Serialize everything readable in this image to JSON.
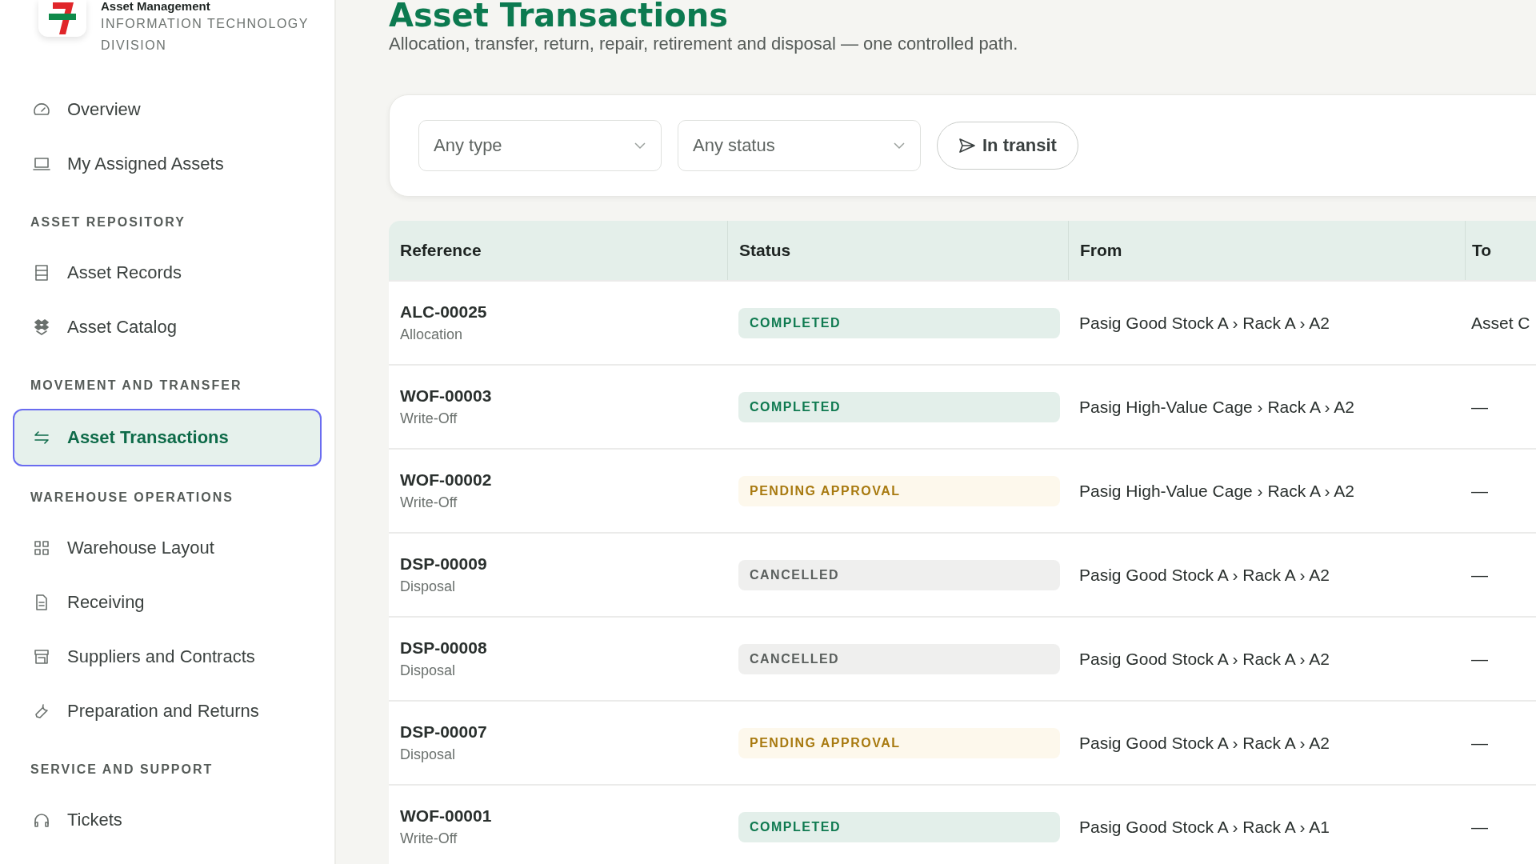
{
  "brand": {
    "name": "Asset Management",
    "subtitle": "INFORMATION TECHNOLOGY DIVISION"
  },
  "sidebar": {
    "sections": [
      {
        "items": [
          {
            "label": "Overview",
            "selected": false
          },
          {
            "label": "My Assigned Assets",
            "selected": false
          }
        ]
      },
      {
        "heading": "ASSET REPOSITORY",
        "items": [
          {
            "label": "Asset Records",
            "selected": false
          },
          {
            "label": "Asset Catalog",
            "selected": false
          }
        ]
      },
      {
        "heading": "MOVEMENT AND TRANSFER",
        "items": [
          {
            "label": "Asset Transactions",
            "selected": true
          }
        ]
      },
      {
        "heading": "WAREHOUSE OPERATIONS",
        "items": [
          {
            "label": "Warehouse Layout",
            "selected": false
          },
          {
            "label": "Receiving",
            "selected": false
          },
          {
            "label": "Suppliers and Contracts",
            "selected": false
          },
          {
            "label": "Preparation and Returns",
            "selected": false
          }
        ]
      },
      {
        "heading": "SERVICE AND SUPPORT",
        "items": [
          {
            "label": "Tickets",
            "selected": false
          }
        ]
      }
    ]
  },
  "page": {
    "title": "Asset Transactions",
    "subtitle": "Allocation, transfer, return, repair, retirement and disposal — one controlled path."
  },
  "filters": {
    "type_select": {
      "value": "Any type"
    },
    "status_select": {
      "value": "Any status"
    },
    "in_transit_button": {
      "label": "In transit"
    }
  },
  "table": {
    "columns": [
      "Reference",
      "Status",
      "From",
      "To"
    ],
    "rows": [
      {
        "reference": "ALC-00025",
        "type": "Allocation",
        "status": {
          "label": "COMPLETED",
          "kind": "completed"
        },
        "from": "Pasig Good Stock A › Rack A › A2",
        "to": "Asset C"
      },
      {
        "reference": "WOF-00003",
        "type": "Write-Off",
        "status": {
          "label": "COMPLETED",
          "kind": "completed"
        },
        "from": "Pasig High-Value Cage › Rack A › A2",
        "to": "—"
      },
      {
        "reference": "WOF-00002",
        "type": "Write-Off",
        "status": {
          "label": "PENDING APPROVAL",
          "kind": "pending"
        },
        "from": "Pasig High-Value Cage › Rack A › A2",
        "to": "—"
      },
      {
        "reference": "DSP-00009",
        "type": "Disposal",
        "status": {
          "label": "CANCELLED",
          "kind": "cancelled"
        },
        "from": "Pasig Good Stock A › Rack A › A2",
        "to": "—"
      },
      {
        "reference": "DSP-00008",
        "type": "Disposal",
        "status": {
          "label": "CANCELLED",
          "kind": "cancelled"
        },
        "from": "Pasig Good Stock A › Rack A › A2",
        "to": "—"
      },
      {
        "reference": "DSP-00007",
        "type": "Disposal",
        "status": {
          "label": "PENDING APPROVAL",
          "kind": "pending"
        },
        "from": "Pasig Good Stock A › Rack A › A2",
        "to": "—"
      },
      {
        "reference": "WOF-00001",
        "type": "Write-Off",
        "status": {
          "label": "COMPLETED",
          "kind": "completed"
        },
        "from": "Pasig Good Stock A › Rack A › A1",
        "to": "—"
      }
    ]
  }
}
